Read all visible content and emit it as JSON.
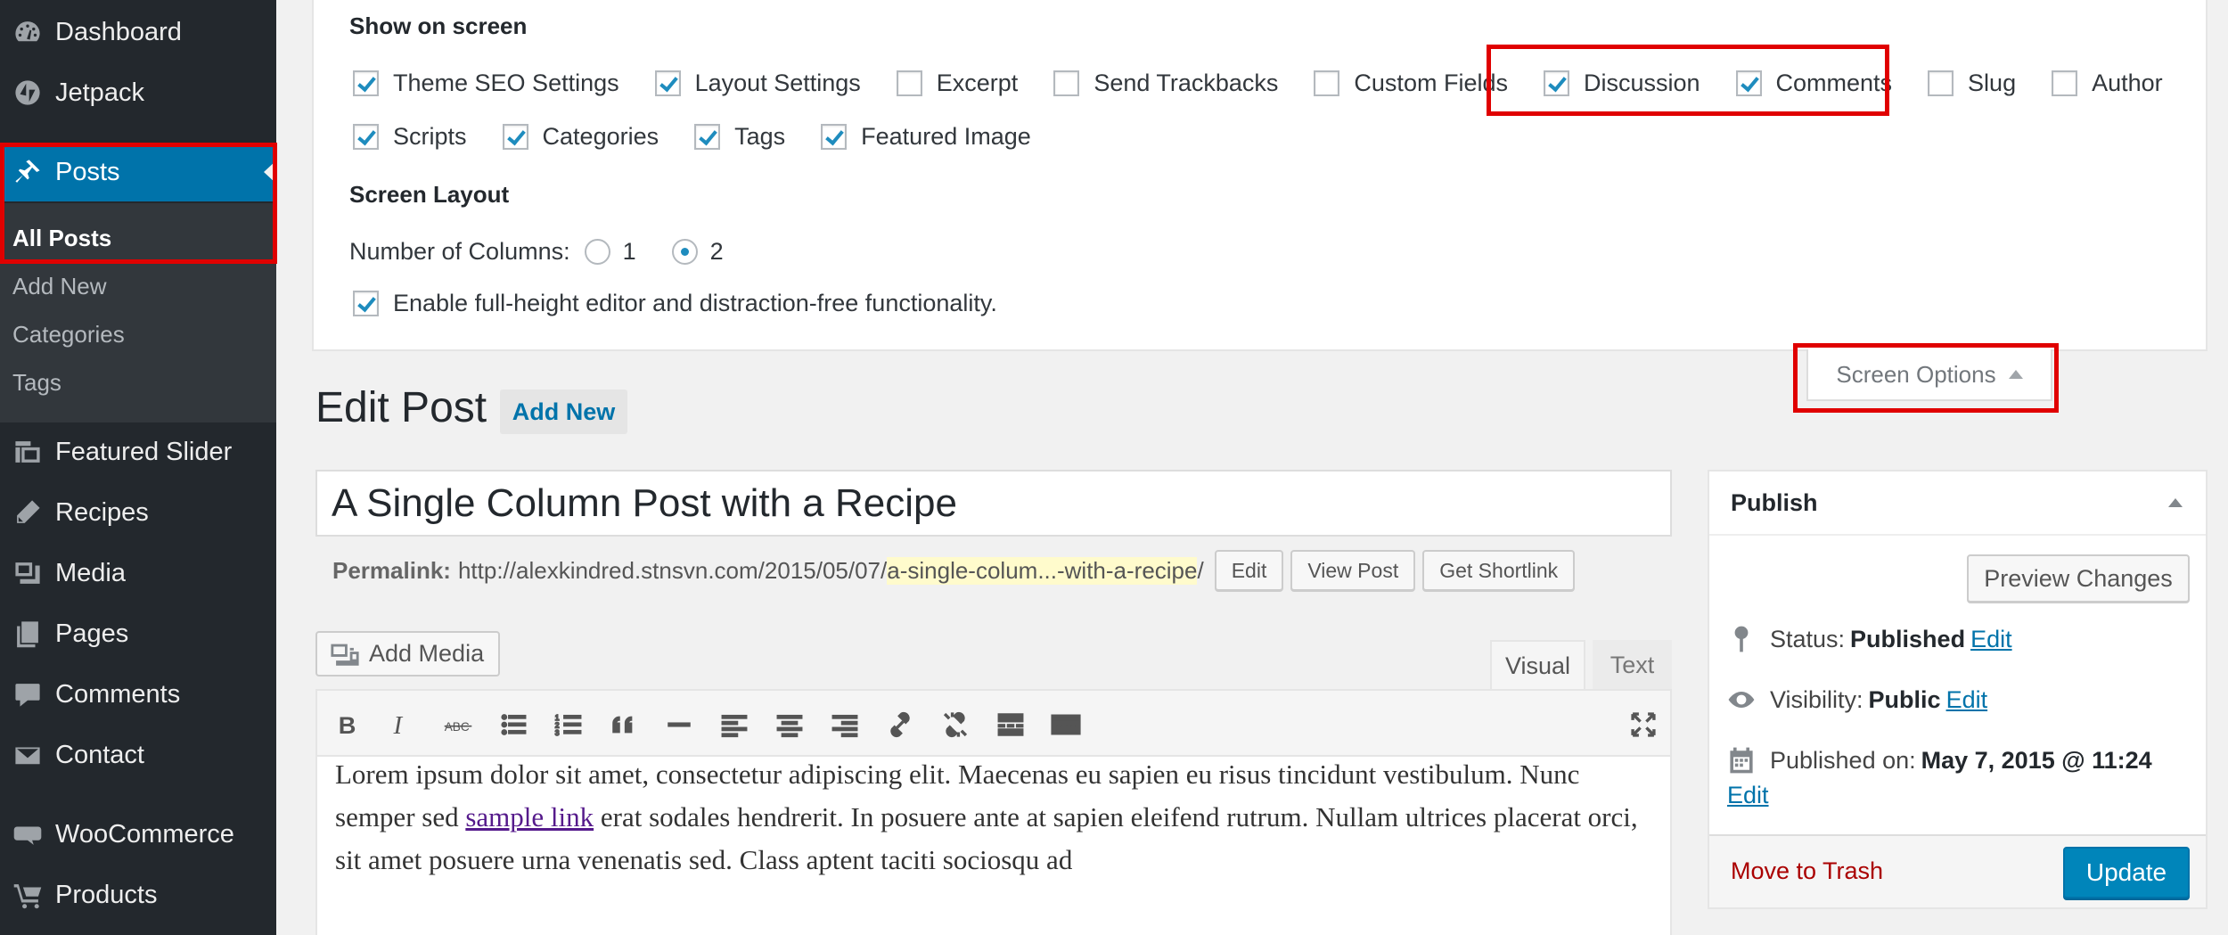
{
  "sidebar": {
    "items": [
      {
        "label": "Dashboard",
        "icon": "dashboard-icon"
      },
      {
        "label": "Jetpack",
        "icon": "jetpack-icon"
      },
      {
        "label": "Posts",
        "icon": "pushpin-icon"
      },
      {
        "label": "Featured Slider",
        "icon": "slides-icon"
      },
      {
        "label": "Recipes",
        "icon": "pencil-icon"
      },
      {
        "label": "Media",
        "icon": "media-icon"
      },
      {
        "label": "Pages",
        "icon": "pages-icon"
      },
      {
        "label": "Comments",
        "icon": "comment-icon"
      },
      {
        "label": "Contact",
        "icon": "email-icon"
      },
      {
        "label": "WooCommerce",
        "icon": "woo-icon"
      },
      {
        "label": "Products",
        "icon": "cart-icon"
      }
    ],
    "submenu": [
      "All Posts",
      "Add New",
      "Categories",
      "Tags"
    ]
  },
  "screen_options": {
    "show_heading": "Show on screen",
    "checkboxes_row1": [
      {
        "label": "Theme SEO Settings",
        "checked": true
      },
      {
        "label": "Layout Settings",
        "checked": true
      },
      {
        "label": "Excerpt",
        "checked": false
      },
      {
        "label": "Send Trackbacks",
        "checked": false
      },
      {
        "label": "Custom Fields",
        "checked": false
      },
      {
        "label": "Discussion",
        "checked": true
      },
      {
        "label": "Comments",
        "checked": true
      },
      {
        "label": "Slug",
        "checked": false
      },
      {
        "label": "Author",
        "checked": false
      }
    ],
    "checkboxes_row2": [
      {
        "label": "Scripts",
        "checked": true
      },
      {
        "label": "Categories",
        "checked": true
      },
      {
        "label": "Tags",
        "checked": true
      },
      {
        "label": "Featured Image",
        "checked": true
      }
    ],
    "layout_heading": "Screen Layout",
    "columns_label": "Number of Columns:",
    "column_options": [
      "1",
      "2"
    ],
    "columns_selected": "2",
    "fullheight_label": "Enable full-height editor and distraction-free functionality.",
    "fullheight_checked": true,
    "tab_label": "Screen Options"
  },
  "header": {
    "title": "Edit Post",
    "add_new": "Add New"
  },
  "post": {
    "title": "A Single Column Post with a Recipe",
    "permalink_label": "Permalink:",
    "permalink_base": "http://alexkindred.stnsvn.com/2015/05/07/",
    "permalink_slug": "a-single-colum...-with-a-recipe",
    "permalink_end": "/",
    "buttons": [
      "Edit",
      "View Post",
      "Get Shortlink"
    ]
  },
  "editor": {
    "add_media": "Add Media",
    "tab_visual": "Visual",
    "tab_text": "Text",
    "content_before_link": "Lorem ipsum dolor sit amet, consectetur adipiscing elit. Maecenas eu sapien eu risus tincidunt vestibulum. Nunc semper sed ",
    "link_text": "sample link",
    "content_after_link": " erat sodales hendrerit. In posuere ante at sapien eleifend rutrum. Nullam ultrices placerat orci, sit amet posuere urna venenatis sed. Class aptent taciti sociosqu ad",
    "toolbar": [
      "bold-icon",
      "italic-icon",
      "strikethrough-icon",
      "bullet-list-icon",
      "numbered-list-icon",
      "blockquote-icon",
      "horizontal-rule-icon",
      "align-left-icon",
      "align-center-icon",
      "align-right-icon",
      "link-icon",
      "unlink-icon",
      "read-more-icon",
      "toolbar-toggle-icon",
      "fullscreen-icon"
    ]
  },
  "publish": {
    "heading": "Publish",
    "preview": "Preview Changes",
    "status_label": "Status:",
    "status_value": "Published",
    "visibility_label": "Visibility:",
    "visibility_value": "Public",
    "published_label": "Published on:",
    "published_value": "May 7, 2015 @ 11:24",
    "edit": "Edit",
    "trash": "Move to Trash",
    "update": "Update"
  },
  "colors": {
    "accent": "#0073aa",
    "highlight_box": "#e00000",
    "sidebar_bg": "#23282d"
  }
}
